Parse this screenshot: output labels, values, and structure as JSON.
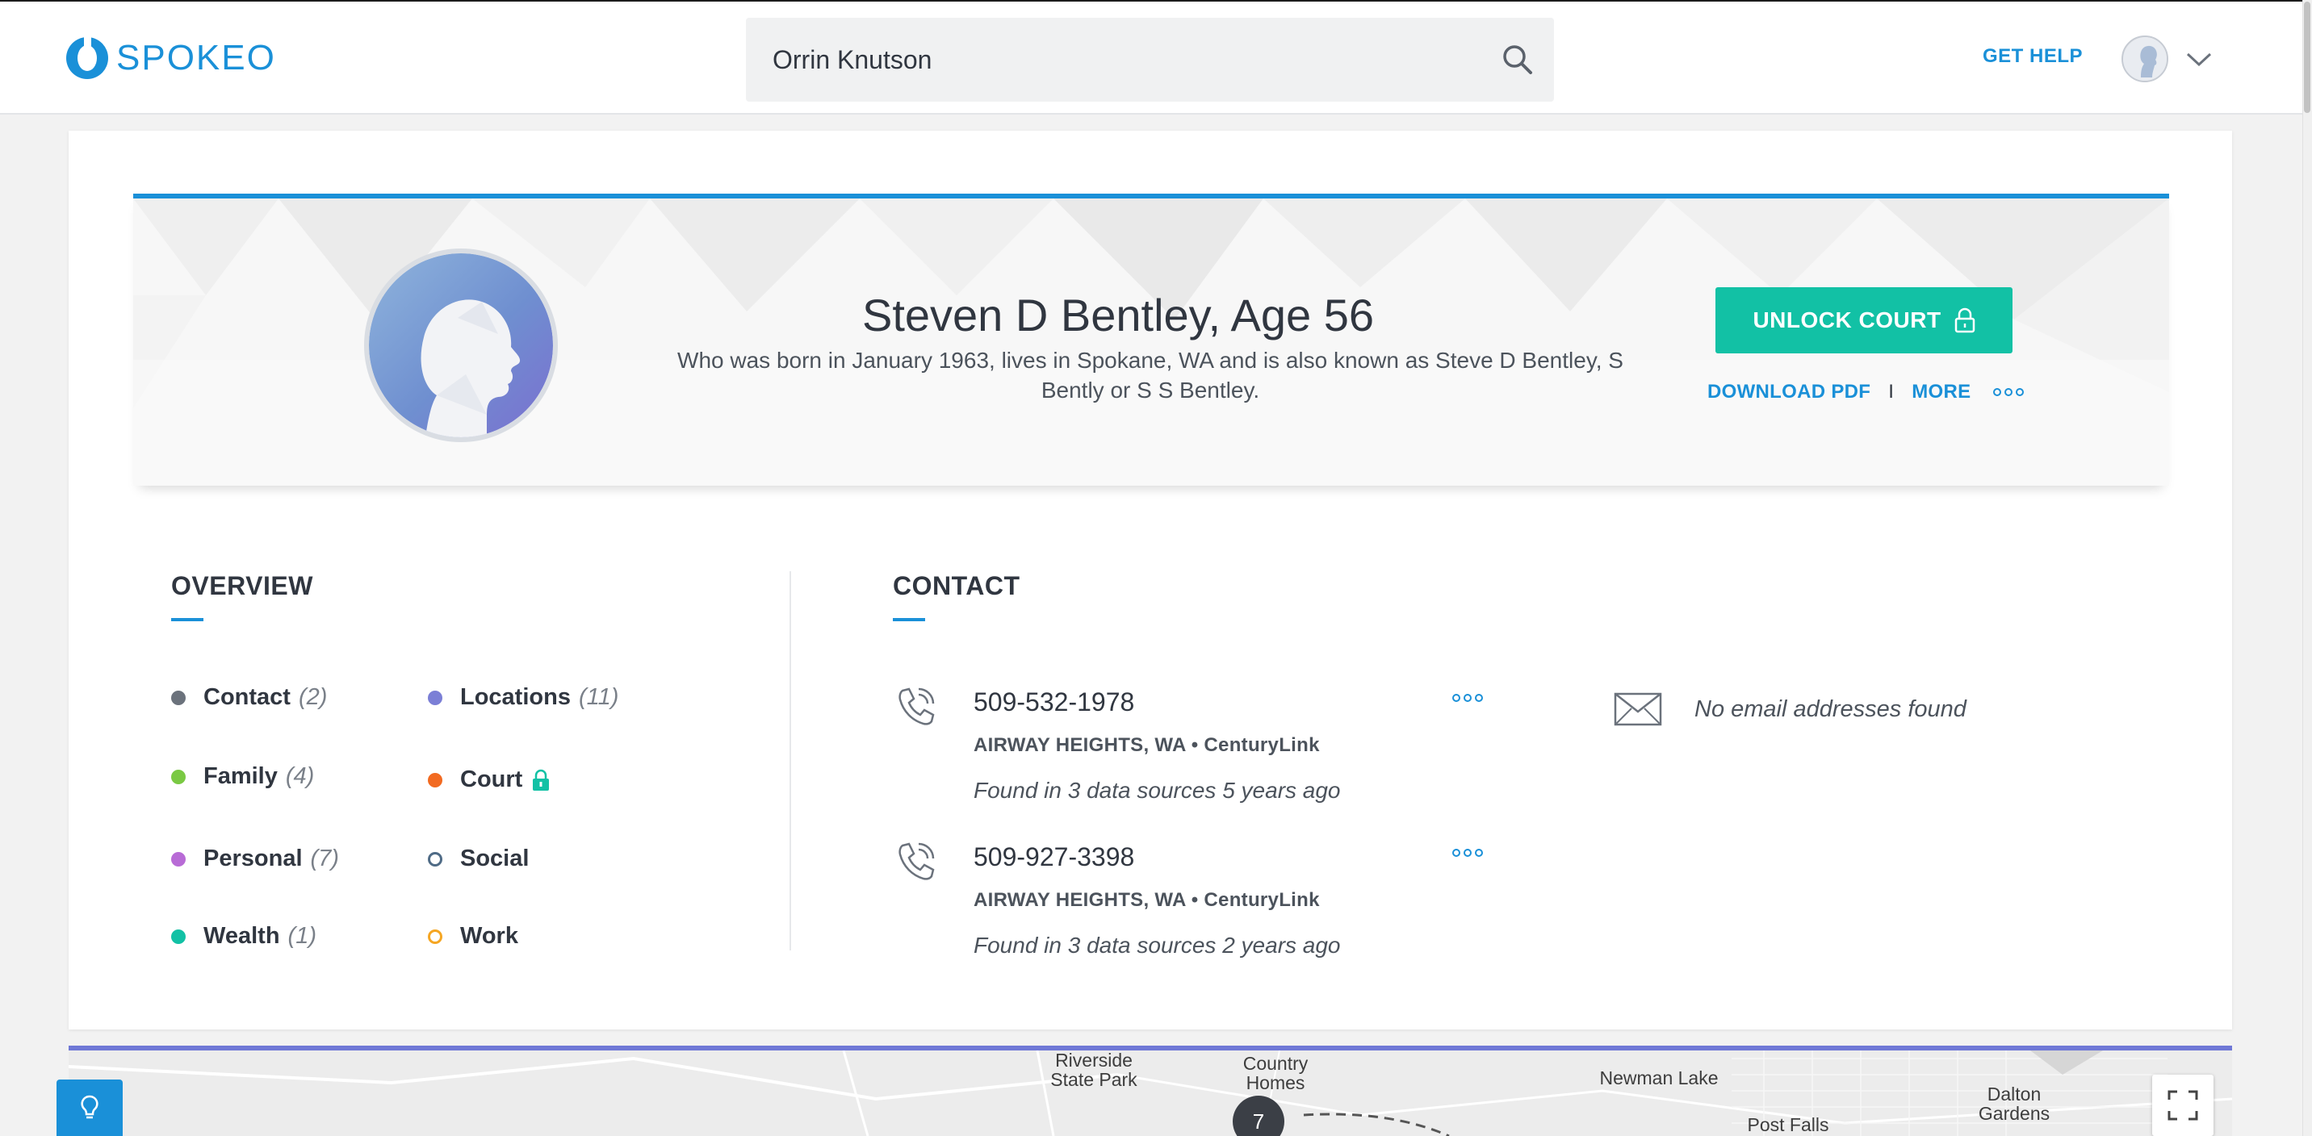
{
  "header": {
    "logo_text": "SPOKEO",
    "search_value": "Orrin Knutson",
    "get_help": "GET HELP"
  },
  "profile": {
    "name": "Steven D Bentley, Age 56",
    "description": "Who was born in January 1963, lives in Spokane, WA and is also known as Steve D Bentley, S Bently or S S Bentley.",
    "unlock_label": "UNLOCK COURT",
    "download_pdf": "DOWNLOAD PDF",
    "separator": "I",
    "more": "MORE"
  },
  "overview": {
    "title": "OVERVIEW",
    "items": [
      {
        "label": "Contact",
        "count": "(2)",
        "color": "#6b727c",
        "ring": false
      },
      {
        "label": "Locations",
        "count": "(11)",
        "color": "#7b7fd6",
        "ring": false
      },
      {
        "label": "Family",
        "count": "(4)",
        "color": "#7ac943",
        "ring": false
      },
      {
        "label": "Court",
        "count": "",
        "color": "#f26a21",
        "ring": false,
        "locked": true
      },
      {
        "label": "Personal",
        "count": "(7)",
        "color": "#b86bd6",
        "ring": false
      },
      {
        "label": "Social",
        "count": "",
        "color": "#4f6b86",
        "ring": true
      },
      {
        "label": "Wealth",
        "count": "(1)",
        "color": "#12c1a5",
        "ring": false
      },
      {
        "label": "Work",
        "count": "",
        "color": "#f5a623",
        "ring": true
      }
    ]
  },
  "contact": {
    "title": "CONTACT",
    "phones": [
      {
        "number": "509-532-1978",
        "location": "AIRWAY HEIGHTS, WA • CenturyLink",
        "found": "Found in 3 data sources 5 years ago"
      },
      {
        "number": "509-927-3398",
        "location": "AIRWAY HEIGHTS, WA • CenturyLink",
        "found": "Found in 3 data sources 2 years ago"
      }
    ],
    "email_text": "No email addresses found"
  },
  "map": {
    "labels": [
      "Riverside State Park",
      "Country Homes",
      "Newman Lake",
      "Dalton Gardens",
      "Post Falls"
    ],
    "pin_count": "7"
  },
  "colors": {
    "brand_blue": "#1a90d8",
    "unlock_teal": "#12c1a5",
    "map_accent": "#6f78d6"
  }
}
